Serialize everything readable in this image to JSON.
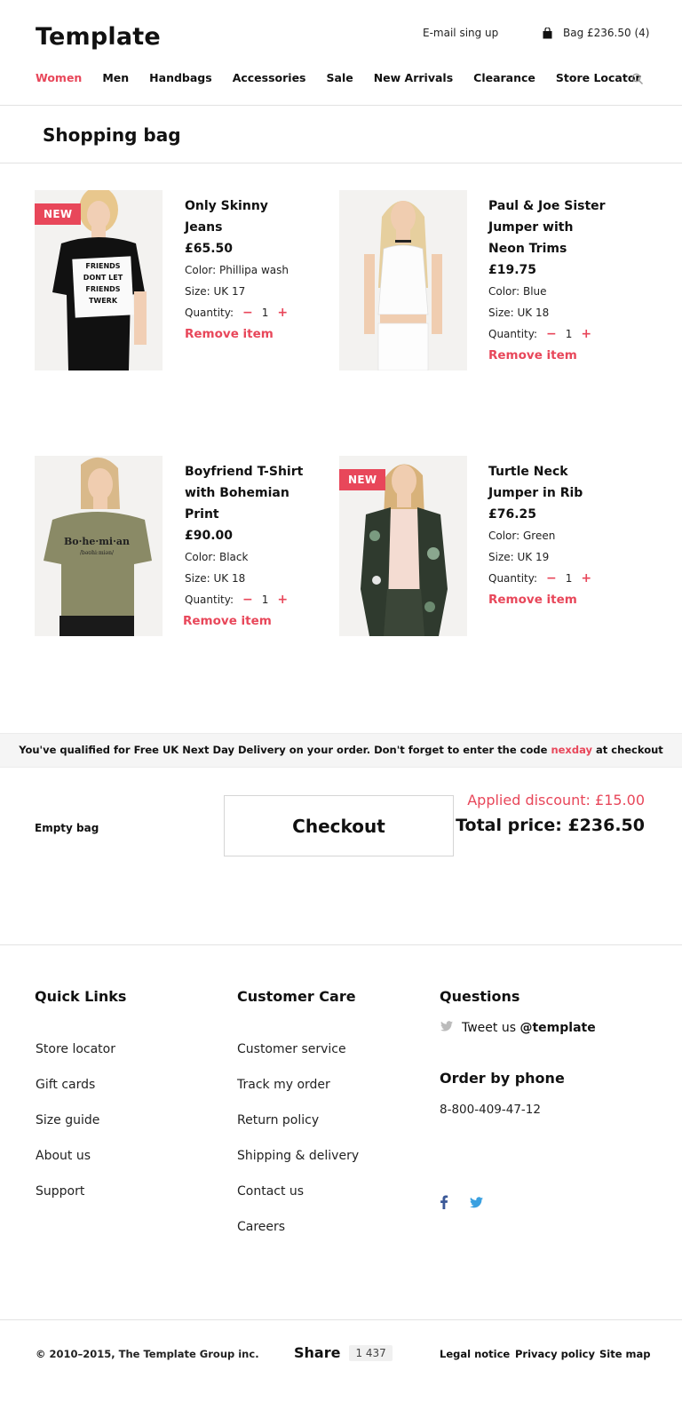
{
  "header": {
    "logo": "Template",
    "signup": "E-mail sing up",
    "bag": "Bag £236.50 (4)",
    "nav": [
      "Women",
      "Men",
      "Handbags",
      "Accessories",
      "Sale",
      "New Arrivals",
      "Clearance",
      "Store Locator"
    ]
  },
  "page_title": "Shopping bag",
  "products": [
    {
      "badge": "NEW",
      "name": "Only Skinny Jeans",
      "price": "£65.50",
      "color": "Color: Phillipa wash",
      "size": "Size: UK 17",
      "qty_label": "Quantity:",
      "qty": "1",
      "remove": "Remove item",
      "image": "black-tshirt-photo"
    },
    {
      "badge": "",
      "name": "Paul & Joe Sister Jumper with Neon Trims",
      "price": "£19.75",
      "color": "Color: Blue",
      "size": "Size: UK 18",
      "qty_label": "Quantity:",
      "qty": "1",
      "remove": "Remove item",
      "image": "white-top-photo"
    },
    {
      "badge": "",
      "name": "Boyfriend T-Shirt with Bohemian Print",
      "price": "£90.00",
      "color": "Color: Black",
      "size": "Size: UK 18",
      "qty_label": "Quantity:",
      "qty": "1",
      "remove": "Remove item",
      "image": "khaki-tshirt-photo"
    },
    {
      "badge": "NEW",
      "name": "Turtle Neck Jumper in Rib",
      "price": "£76.25",
      "color": "Color: Green",
      "size": "Size: UK 19",
      "qty_label": "Quantity:",
      "qty": "1",
      "remove": "Remove item",
      "image": "floral-jacket-photo"
    }
  ],
  "promo": {
    "before": "You've qualified for Free UK Next Day Delivery on your order. Don't forget to enter the code ",
    "code": "nexday",
    "after": " at checkout"
  },
  "summary": {
    "empty_bag": "Empty bag",
    "checkout": "Checkout",
    "discount": "Applied discount: £15.00",
    "total": "Total price: £236.50"
  },
  "footer": {
    "quick_links_title": "Quick Links",
    "quick_links": [
      "Store locator",
      "Gift cards",
      "Size guide",
      "About us",
      "Support"
    ],
    "customer_care_title": "Customer Care",
    "customer_care": [
      "Customer service",
      "Track my order",
      "Return policy",
      "Shipping & delivery",
      "Contact us",
      "Careers"
    ],
    "questions_title": "Questions",
    "tweet_text": "Tweet us",
    "tweet_handle": "@template",
    "phone_title": "Order by phone",
    "phone": "8-800-409-47-12",
    "copyright": "© 2010–2015, The Template Group inc.",
    "share_label": "Share",
    "share_count": "1 437",
    "legal": [
      "Legal notice",
      "Privacy policy",
      "Site map"
    ]
  },
  "colors": {
    "accent": "#e8475a",
    "twitter": "#3aa0e0",
    "facebook": "#3b5998"
  }
}
